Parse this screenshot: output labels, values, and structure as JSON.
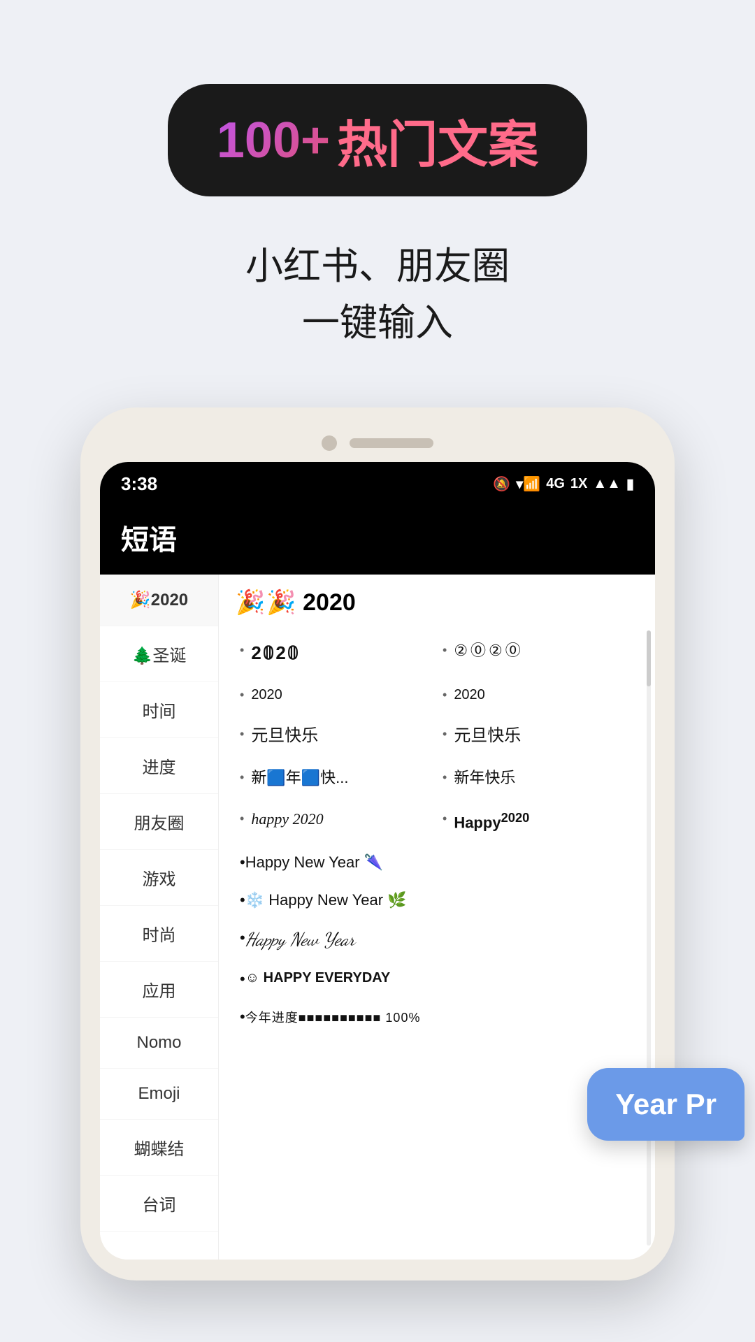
{
  "top": {
    "badge": {
      "number": "100+",
      "text": "热门文案"
    },
    "subtitle_line1": "小红书、朋友圈",
    "subtitle_line2": "一键输入"
  },
  "phone": {
    "status_bar": {
      "time": "3:38",
      "icons": "🔕 📶 4G 1X 📶 🔋"
    },
    "app_title": "短语",
    "sidebar_items": [
      {
        "label": "🎉2020",
        "active": true
      },
      {
        "label": "🌲圣诞",
        "active": false
      },
      {
        "label": "时间",
        "active": false
      },
      {
        "label": "进度",
        "active": false
      },
      {
        "label": "朋友圈",
        "active": false
      },
      {
        "label": "游戏",
        "active": false
      },
      {
        "label": "时尚",
        "active": false
      },
      {
        "label": "应用",
        "active": false
      },
      {
        "label": "Nomo",
        "active": false
      },
      {
        "label": "Emoji",
        "active": false
      },
      {
        "label": "蝴蝶结",
        "active": false
      },
      {
        "label": "台词",
        "active": false
      }
    ],
    "list_title": "🎉 2020",
    "items": [
      {
        "text": "2𝟘2𝟘",
        "style": "styled-2020",
        "full_width": false
      },
      {
        "text": "②⓪②⓪",
        "style": "circled",
        "full_width": false
      },
      {
        "text": "2020",
        "style": "small-2020",
        "full_width": false
      },
      {
        "text": "2020",
        "style": "small-2020",
        "full_width": false
      },
      {
        "text": "元旦快乐",
        "style": "yuandan",
        "full_width": false
      },
      {
        "text": "元旦快乐",
        "style": "yuandan",
        "full_width": false
      },
      {
        "text": "新🟦年🟦快...",
        "style": "",
        "full_width": false
      },
      {
        "text": "新年快乐",
        "style": "",
        "full_width": false
      },
      {
        "text": "happy 2020",
        "style": "new-year-italic",
        "full_width": false
      },
      {
        "text": "Happy²⁰²⁰",
        "style": "happy-bold",
        "full_width": false
      },
      {
        "text": "Happy New Year 🌂",
        "style": "happy-new-year-emoji",
        "full_width": true
      },
      {
        "text": "❄️ Happy New Year 🌿",
        "style": "happy-new-year-emoji",
        "full_width": true
      },
      {
        "text": "Happy New Year",
        "style": "script-font",
        "full_width": true
      },
      {
        "text": "☺ HAPPY EVERYDAY",
        "style": "happy-everyday",
        "full_width": true
      },
      {
        "text": "今年进度■■■■■■■■■■ 100%",
        "style": "progress-bar",
        "full_width": true
      }
    ],
    "speech_bubble_text": "Year Pr"
  }
}
